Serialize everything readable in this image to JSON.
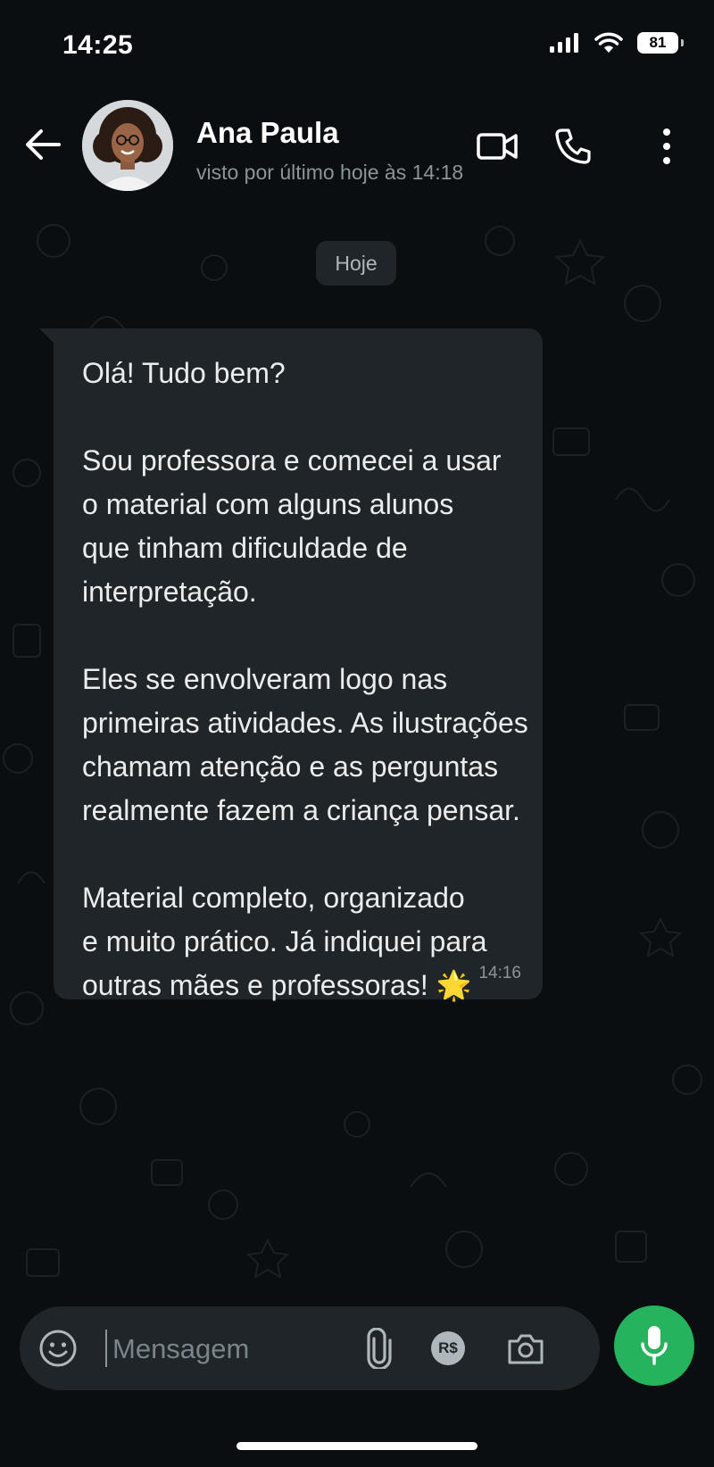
{
  "status_bar": {
    "time": "14:25",
    "battery": "81",
    "icons": [
      "signal-icon",
      "wifi-icon",
      "battery-icon"
    ]
  },
  "header": {
    "contact_name": "Ana Paula",
    "last_seen": "visto por último hoje às 14:18",
    "icons": [
      "back-arrow-icon",
      "avatar",
      "video-call-icon",
      "phone-icon",
      "more-options-icon"
    ]
  },
  "chat": {
    "date_chip": "Hoje",
    "messages": [
      {
        "text": "Olá! Tudo bem?\n\nSou professora e comecei a usar\no material com alguns alunos\nque tinham dificuldade de\ninterpretação.\n\nEles se envolveram logo nas\nprimeiras atividades. As ilustrações\nchamam atenção e as perguntas\nrealmente fazem a criança pensar.\n\nMaterial completo, organizado\ne muito prático. Já indiquei para\noutras mães e professoras! 🌟",
        "time": "14:16",
        "direction": "incoming"
      }
    ]
  },
  "composer": {
    "placeholder": "Mensagem",
    "value": "",
    "icons": [
      "emoji-icon",
      "attach-icon",
      "payment-icon",
      "camera-icon",
      "microphone-icon"
    ],
    "payment_label": "R$"
  },
  "colors": {
    "background": "#0b0e10",
    "bubble_incoming": "#1f2529",
    "mic_button": "#25b35e",
    "secondary_text": "#8a9499"
  }
}
